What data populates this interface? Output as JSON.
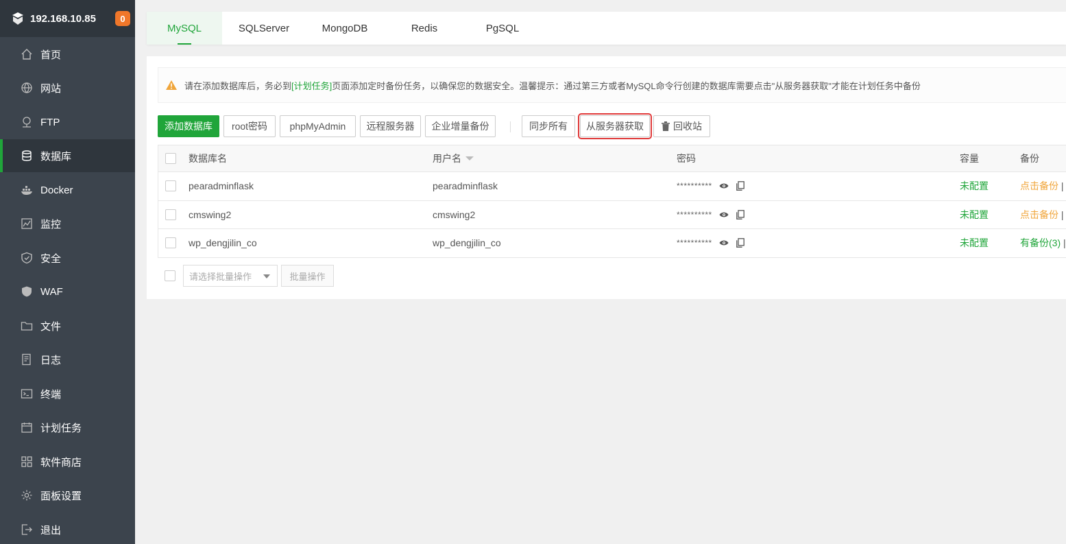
{
  "sidebar": {
    "host": "192.168.10.85",
    "badge": "0",
    "items": [
      {
        "label": "首页",
        "icon": "home-icon"
      },
      {
        "label": "网站",
        "icon": "globe-icon"
      },
      {
        "label": "FTP",
        "icon": "ftp-icon"
      },
      {
        "label": "数据库",
        "icon": "database-icon"
      },
      {
        "label": "Docker",
        "icon": "docker-icon"
      },
      {
        "label": "监控",
        "icon": "monitor-icon"
      },
      {
        "label": "安全",
        "icon": "shield-icon"
      },
      {
        "label": "WAF",
        "icon": "waf-icon"
      },
      {
        "label": "文件",
        "icon": "folder-icon"
      },
      {
        "label": "日志",
        "icon": "log-icon"
      },
      {
        "label": "终端",
        "icon": "terminal-icon"
      },
      {
        "label": "计划任务",
        "icon": "calendar-icon"
      },
      {
        "label": "软件商店",
        "icon": "apps-icon"
      },
      {
        "label": "面板设置",
        "icon": "gear-icon"
      },
      {
        "label": "退出",
        "icon": "logout-icon"
      }
    ],
    "active_index": 3
  },
  "tabs": [
    "MySQL",
    "SQLServer",
    "MongoDB",
    "Redis",
    "PgSQL"
  ],
  "notice": {
    "pre": "请在添加数据库后，务必到",
    "link": "[计划任务]",
    "post": "页面添加定时备份任务，以确保您的数据安全。温馨提示：通过第三方或者MySQL命令行创建的数据库需要点击\"从服务器获取\"才能在计划任务中备份"
  },
  "toolbar": {
    "add_db": "添加数据库",
    "root_pw": "root密码",
    "phpmyadmin": "phpMyAdmin",
    "remote": "远程服务器",
    "enterprise_backup": "企业增量备份",
    "sync_all": "同步所有",
    "fetch_server": "从服务器获取",
    "recycle": "回收站"
  },
  "table": {
    "headers": {
      "name": "数据库名",
      "user": "用户名",
      "password": "密码",
      "capacity": "容量",
      "backup": "备份"
    },
    "rows": [
      {
        "name": "pearadminflask",
        "user": "pearadminflask",
        "password": "**********",
        "capacity": "未配置",
        "backup": "点击备份",
        "backup_tail": "| 导"
      },
      {
        "name": "cmswing2",
        "user": "cmswing2",
        "password": "**********",
        "capacity": "未配置",
        "backup": "点击备份",
        "backup_tail": "| 导"
      },
      {
        "name": "wp_dengjilin_co",
        "user": "wp_dengjilin_co",
        "password": "**********",
        "capacity": "未配置",
        "backup": "有备份(3)",
        "backup_tail": "|"
      }
    ]
  },
  "bulk": {
    "placeholder": "请选择批量操作",
    "button": "批量操作"
  },
  "colors": {
    "accent": "#20a53a",
    "sidebar": "#3c444d",
    "sidebar_head": "#2f363d",
    "badge": "#f0772a",
    "warn": "#f0a53a",
    "highlight": "#e03a3a"
  }
}
